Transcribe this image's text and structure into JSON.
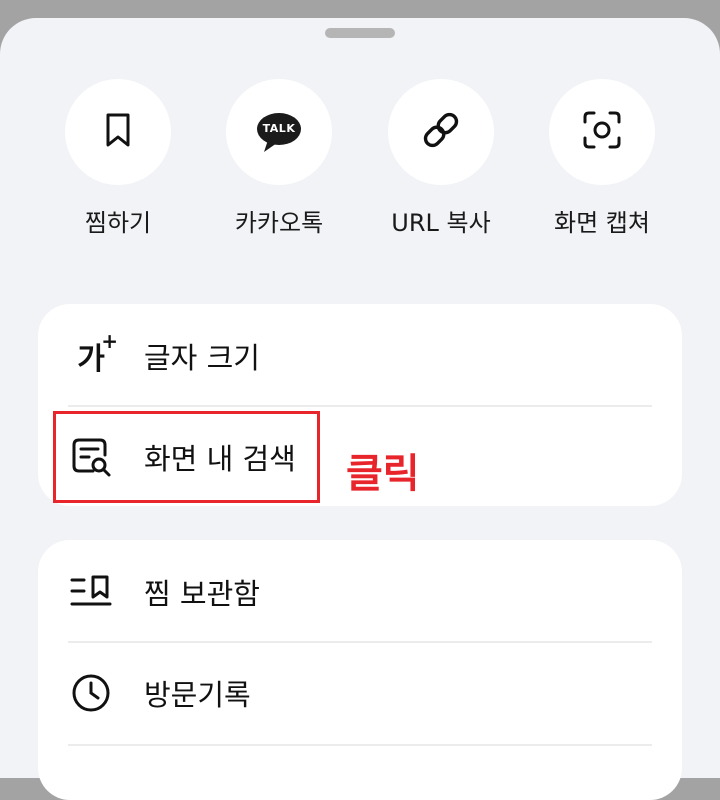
{
  "share_actions": [
    {
      "label": "찜하기",
      "icon": "bookmark-icon"
    },
    {
      "label": "카카오톡",
      "icon": "kakaotalk-icon",
      "badge": "TALK"
    },
    {
      "label": "URL 복사",
      "icon": "link-icon"
    },
    {
      "label": "화면 캡쳐",
      "icon": "screen-capture-icon"
    }
  ],
  "menu_primary": [
    {
      "label": "글자 크기",
      "icon": "font-size-icon",
      "icon_glyph": "가"
    },
    {
      "label": "화면 내 검색",
      "icon": "find-in-page-icon"
    }
  ],
  "menu_secondary": [
    {
      "label": "찜 보관함",
      "icon": "bookmark-list-icon"
    },
    {
      "label": "방문기록",
      "icon": "clock-history-icon"
    }
  ],
  "annotation": {
    "text": "클릭",
    "color": "#e8252a"
  }
}
